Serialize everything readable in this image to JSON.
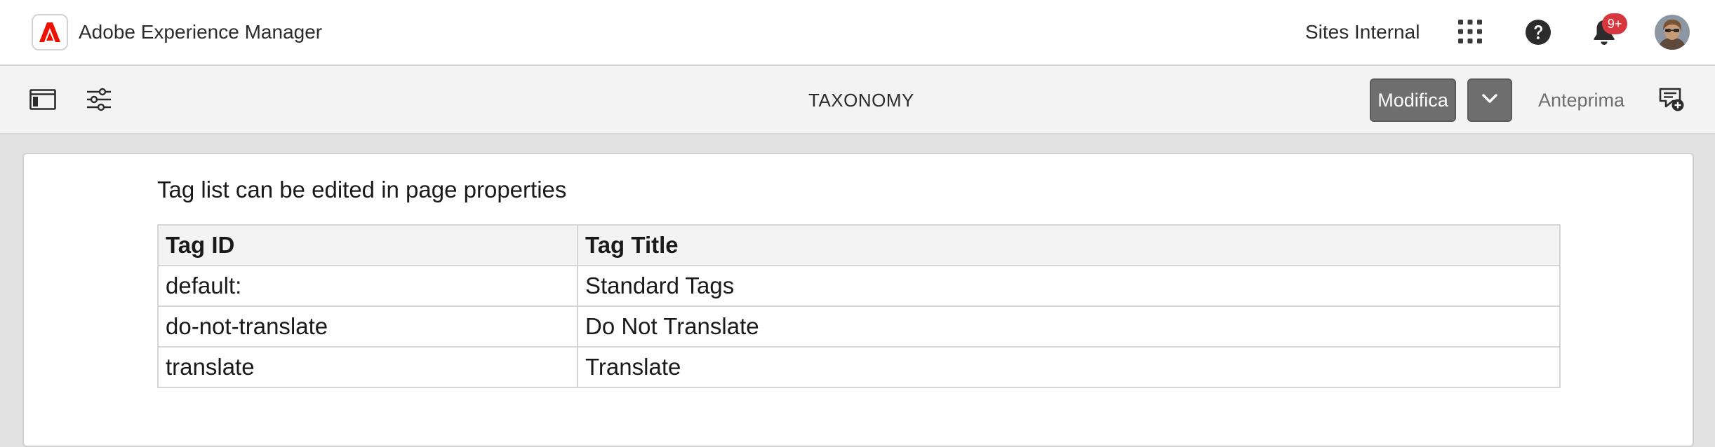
{
  "shell": {
    "app_title": "Adobe Experience Manager",
    "site_label": "Sites Internal",
    "notification_badge": "9+",
    "icons": [
      "adobe-logo-icon",
      "apps-grid-icon",
      "help-icon",
      "bell-icon",
      "avatar"
    ]
  },
  "toolbar": {
    "page_name": "TAXONOMY",
    "mode_label": "Modifica",
    "preview_label": "Anteprima",
    "icons": [
      "side-panel-icon",
      "page-properties-icon",
      "chevron-down-icon",
      "annotate-icon"
    ]
  },
  "content": {
    "info_text": "Tag list can be edited in page properties",
    "table": {
      "headers": [
        "Tag ID",
        "Tag Title"
      ],
      "rows": [
        [
          "default:",
          "Standard Tags"
        ],
        [
          "do-not-translate",
          "Do Not Translate"
        ],
        [
          "translate",
          "Translate"
        ]
      ]
    }
  },
  "colors": {
    "adobe_red": "#eb1000",
    "badge_red": "#d7373f",
    "mode_button_bg": "#6e6e6e"
  }
}
